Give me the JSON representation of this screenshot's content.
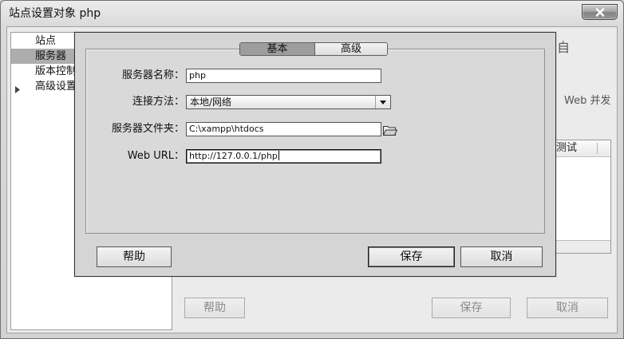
{
  "window": {
    "title": "站点设置对象 php"
  },
  "sidebar": {
    "items": [
      {
        "label": "站点",
        "selected": false
      },
      {
        "label": "服务器",
        "selected": true
      },
      {
        "label": "版本控制",
        "selected": false
      },
      {
        "label": "高级设置",
        "selected": false,
        "expandable": true
      }
    ]
  },
  "background_page": {
    "description_fragment": "自",
    "concurrency_label": "Web 并发",
    "server_table": {
      "columns": [
        "测试"
      ]
    },
    "buttons": {
      "help": "帮助",
      "save": "保存",
      "cancel": "取消"
    },
    "buttons_disabled": true
  },
  "modal": {
    "tabs": [
      {
        "label": "基本",
        "selected": true
      },
      {
        "label": "高级",
        "selected": false
      }
    ],
    "fields": {
      "server_name": {
        "label": "服务器名称：",
        "value": "php"
      },
      "connection_method": {
        "label": "连接方法：",
        "value": "本地/网络"
      },
      "server_folder": {
        "label": "服务器文件夹：",
        "value": "C:\\xampp\\htdocs"
      },
      "web_url": {
        "label": "Web URL：",
        "value": "http://127.0.0.1/php",
        "focused": true
      }
    },
    "buttons": {
      "help": "帮助",
      "save": "保存",
      "cancel": "取消"
    }
  },
  "icons": {
    "close": "close-icon",
    "expand": "expand-arrow-icon",
    "dropdown": "chevron-down-icon",
    "folder": "folder-icon"
  },
  "colors": {
    "client_background": "#ebebeb",
    "sidebar_selected": "#adadad",
    "modal_background": "#d5d5d5",
    "modal_border": "#333333",
    "tab_selected": "#9d9d9d"
  }
}
